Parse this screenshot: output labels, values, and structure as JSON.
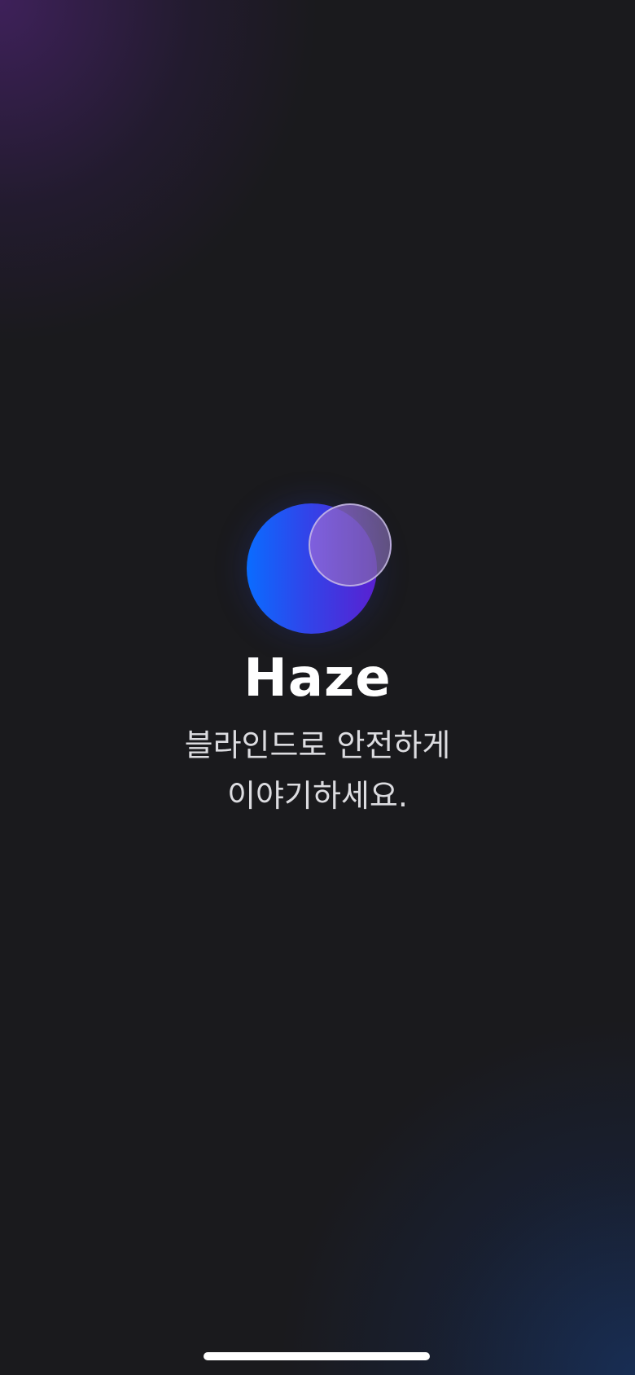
{
  "app": {
    "title": "Haze",
    "tagline_line1": "블라인드로 안전하게",
    "tagline_line2": "이야기하세요."
  },
  "logo": {
    "icon": "overlapping-circles-logo"
  },
  "colors": {
    "background": "#1a1a1d",
    "glow_top_left": "#5c268c",
    "glow_bottom_right": "#183466",
    "logo_gradient_start": "#0a6cff",
    "logo_gradient_end": "#5a20d0"
  }
}
